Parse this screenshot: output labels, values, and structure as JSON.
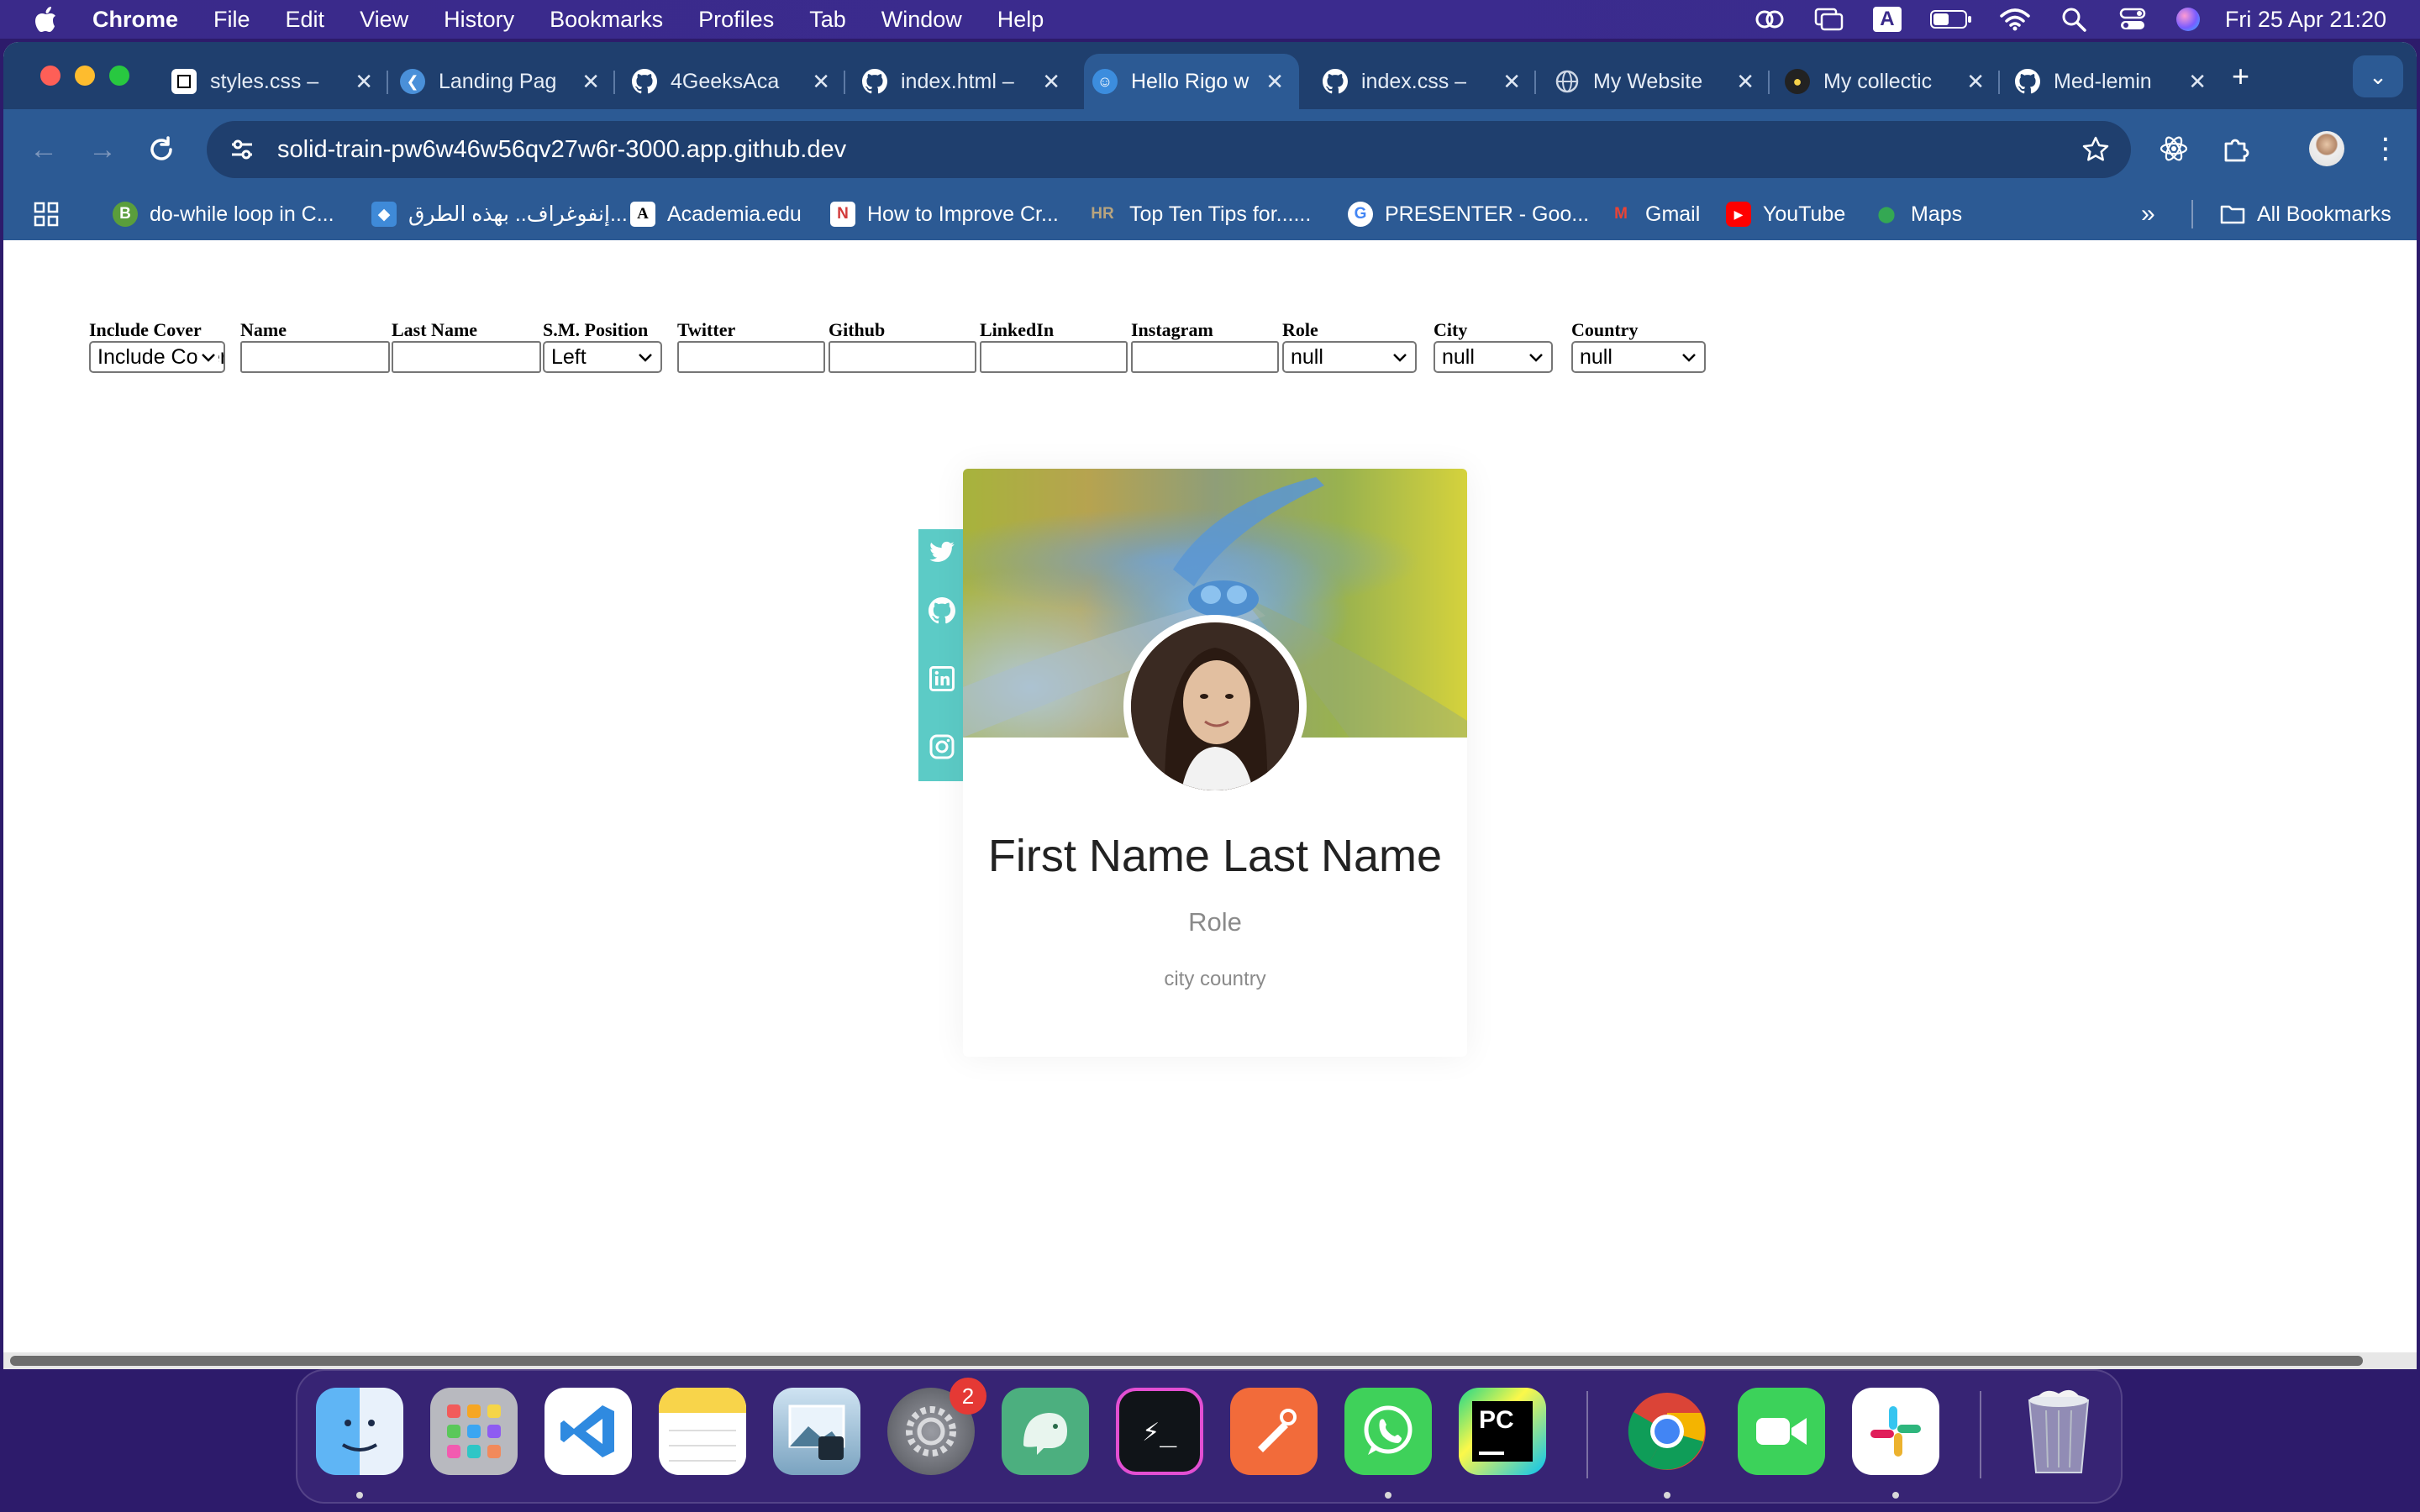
{
  "menubar": {
    "app_name": "Chrome",
    "items": [
      "File",
      "Edit",
      "View",
      "History",
      "Bookmarks",
      "Profiles",
      "Tab",
      "Window",
      "Help"
    ],
    "status_icons": [
      "creative-cloud-icon",
      "screen-mirroring-icon",
      "input-source-icon",
      "battery-icon",
      "wifi-icon",
      "spotlight-search-icon",
      "control-center-icon",
      "siri-icon"
    ],
    "input_source": "A",
    "clock": "Fri 25 Apr  21:20"
  },
  "tabs": [
    {
      "title": "styles.css –",
      "icon": "codepen-icon",
      "active": false
    },
    {
      "title": "Landing Pag",
      "icon": "landing-page-icon",
      "active": false
    },
    {
      "title": "4GeeksAca",
      "icon": "github-icon",
      "active": false
    },
    {
      "title": "index.html –",
      "icon": "github-icon",
      "active": false
    },
    {
      "title": "Hello Rigo w",
      "icon": "rigo-icon",
      "active": true
    },
    {
      "title": "index.css –",
      "icon": "github-icon",
      "active": false
    },
    {
      "title": "My Website",
      "icon": "globe-icon",
      "active": false
    },
    {
      "title": "My collectic",
      "icon": "collection-icon",
      "active": false
    },
    {
      "title": "Med-lemin",
      "icon": "github-icon",
      "active": false
    }
  ],
  "omnibox": {
    "url": "solid-train-pw6w46w56qv27w6r-3000.app.github.dev"
  },
  "bookmarks": [
    {
      "label": "do-while loop in C...",
      "icon": "B",
      "color": "#5a9e3c"
    },
    {
      "label": "إنفوغراف.. بهذه الطرق...",
      "icon": "◆",
      "color": "#3f8ad8"
    },
    {
      "label": "Academia.edu",
      "icon": "A",
      "color": "#ffffff"
    },
    {
      "label": "How to Improve Cr...",
      "icon": "N",
      "color": "#d23b3b"
    },
    {
      "label": "Top Ten Tips for......",
      "icon": "HR",
      "color": "#9a8a6a"
    },
    {
      "label": "PRESENTER - Goo...",
      "icon": "G",
      "color": "#ffffff"
    },
    {
      "label": "Gmail",
      "icon": "M",
      "color": "#ea4335"
    },
    {
      "label": "YouTube",
      "icon": "▶",
      "color": "#ff0000"
    },
    {
      "label": "Maps",
      "icon": "⬤",
      "color": "#34a853"
    }
  ],
  "all_bookmarks_label": "All Bookmarks",
  "form": {
    "include_cover": {
      "label": "Include Cover",
      "value": "Include Cover"
    },
    "name": {
      "label": "Name",
      "value": ""
    },
    "last_name": {
      "label": "Last Name",
      "value": ""
    },
    "sm_position": {
      "label": "S.M. Position",
      "value": "Left"
    },
    "twitter": {
      "label": "Twitter",
      "value": ""
    },
    "github": {
      "label": "Github",
      "value": ""
    },
    "linkedin": {
      "label": "LinkedIn",
      "value": ""
    },
    "instagram": {
      "label": "Instagram",
      "value": ""
    },
    "role": {
      "label": "Role",
      "value": "null"
    },
    "city": {
      "label": "City",
      "value": "null"
    },
    "country": {
      "label": "Country",
      "value": "null"
    }
  },
  "card": {
    "name": "First Name Last Name",
    "role": "Role",
    "location": "city country",
    "social_icons": [
      "twitter-icon",
      "github-icon",
      "linkedin-icon",
      "instagram-icon"
    ],
    "social_bar_color": "#5ccbc6"
  },
  "dock": {
    "apps": [
      "Finder",
      "Launchpad",
      "Visual Studio Code",
      "Notes",
      "Preview",
      "System Settings",
      "DBngin",
      "iTerm",
      "Postman",
      "WhatsApp",
      "PyCharm",
      "Google Chrome",
      "FaceTime",
      "Slack",
      "Trash"
    ],
    "system_settings_badge": "2"
  }
}
